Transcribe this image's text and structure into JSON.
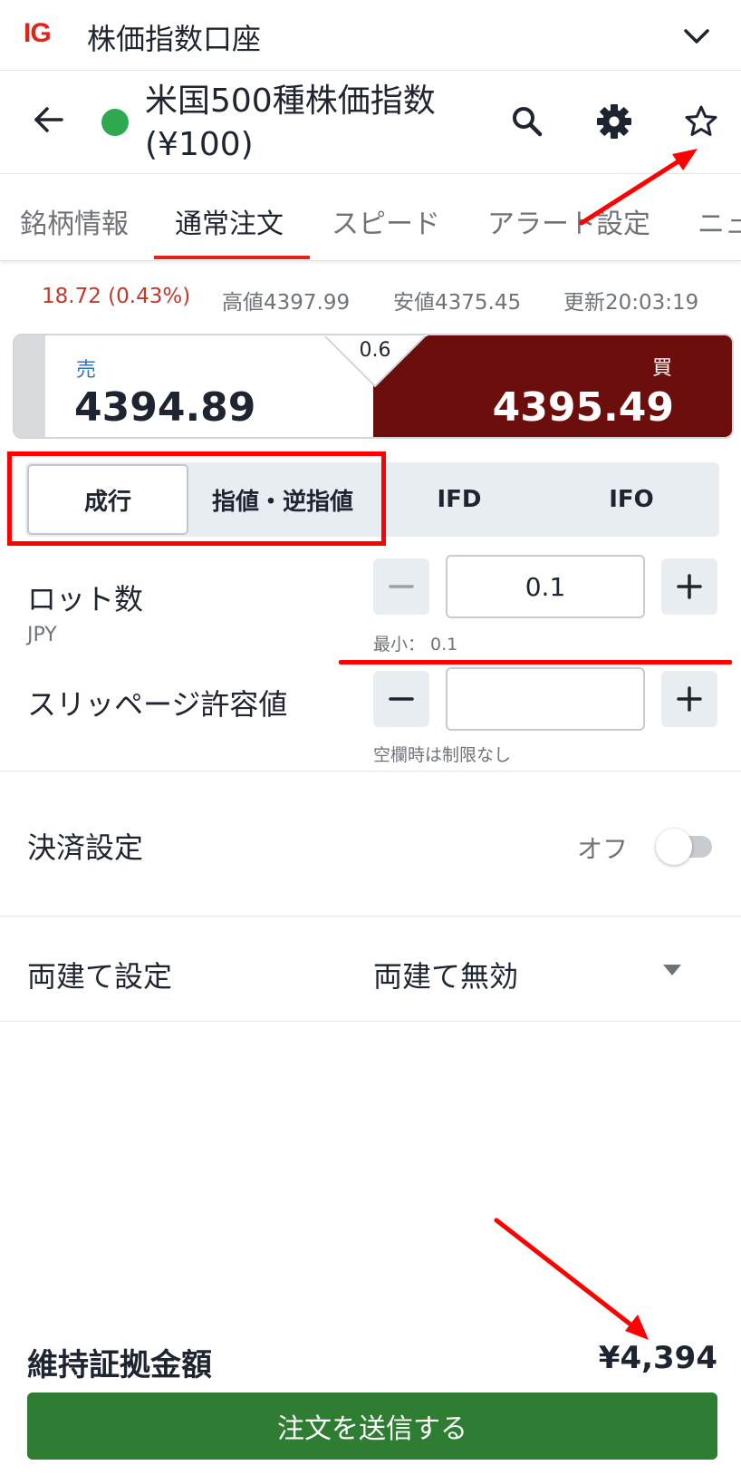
{
  "account": {
    "logo": "IG",
    "title": "株価指数口座"
  },
  "instrument": {
    "name_line1": "米国500種株価指数",
    "name_line2": "(¥100)",
    "status_color": "#2fa84f"
  },
  "tabs": [
    {
      "label": "銘柄情報"
    },
    {
      "label": "通常注文"
    },
    {
      "label": "スピード"
    },
    {
      "label": "アラート設定"
    },
    {
      "label": "ニュ"
    }
  ],
  "stats": {
    "change": "18.72 (0.43%)",
    "high": "高値4397.99",
    "low": "安値4375.45",
    "updated": "更新20:03:19"
  },
  "prices": {
    "sell_label": "売",
    "sell_price": "4394.89",
    "spread": "0.6",
    "buy_label": "買",
    "buy_price": "4395.49",
    "buy_color": "#6c0f0c"
  },
  "order_types": [
    {
      "label": "成行",
      "selected": true
    },
    {
      "label": "指値・逆指値",
      "selected": false
    },
    {
      "label": "IFD",
      "selected": false
    },
    {
      "label": "IFO",
      "selected": false
    }
  ],
  "lot": {
    "label": "ロット数",
    "unit": "JPY",
    "value": "0.1",
    "hint": "最小： 0.1"
  },
  "slippage": {
    "label": "スリッページ許容値",
    "value": "",
    "hint": "空欄時は制限なし"
  },
  "settlement": {
    "label": "決済設定",
    "toggle_text": "オフ",
    "enabled": false
  },
  "hedge": {
    "label": "両建て設定",
    "value": "両建て無効"
  },
  "margin": {
    "label": "維持証拠金額",
    "value": "¥4,394"
  },
  "submit": {
    "label": "注文を送信する",
    "color": "#2e7d32"
  },
  "annotation_color": "#ff0000"
}
